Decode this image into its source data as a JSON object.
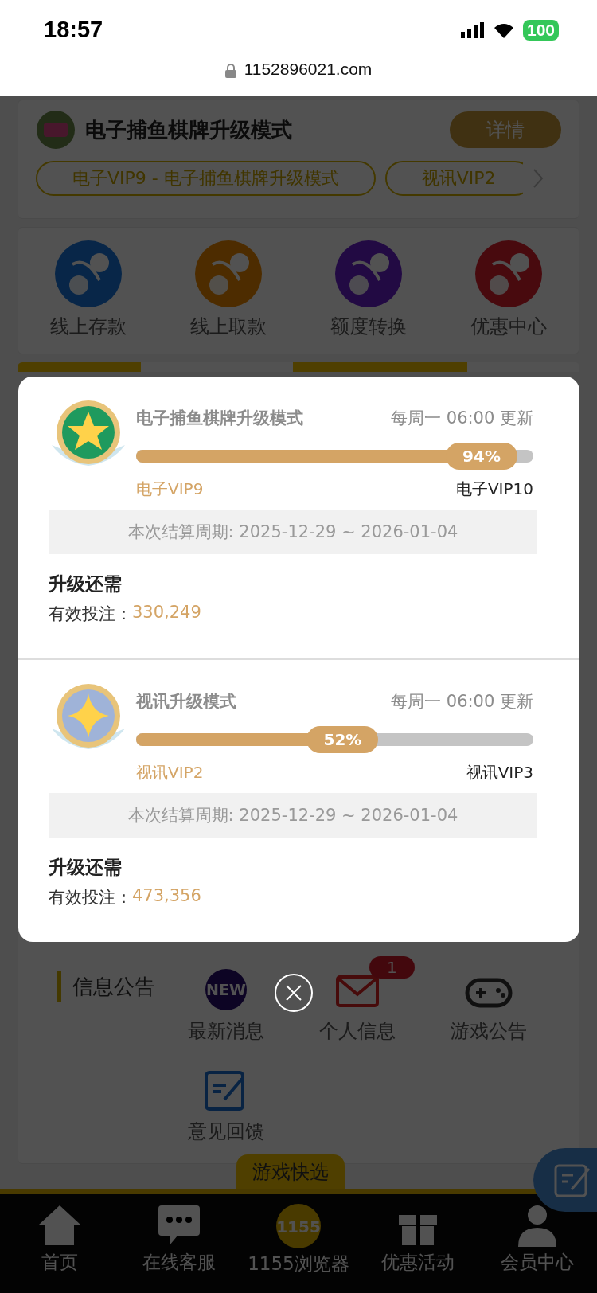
{
  "status_bar": {
    "time": "18:57",
    "battery": "100"
  },
  "browser": {
    "url": "1152896021.com"
  },
  "promo_card": {
    "title": "电子捕鱼棋牌升级模式",
    "details_button": "详情",
    "chips": [
      "电子VIP9 - 电子捕鱼棋牌升级模式",
      "视讯VIP2"
    ]
  },
  "quick_actions": [
    {
      "kind": "deposit",
      "label": "线上存款"
    },
    {
      "kind": "withdraw",
      "label": "线上取款"
    },
    {
      "kind": "transfer",
      "label": "额度转换"
    },
    {
      "kind": "promo",
      "label": "优惠中心"
    }
  ],
  "notice_section": {
    "title": "信息公告",
    "items": [
      {
        "kind": "new",
        "label": "最新消息",
        "icon_text": "NEW"
      },
      {
        "kind": "mail",
        "label": "个人信息",
        "badge": "1"
      },
      {
        "kind": "game",
        "label": "游戏公告"
      },
      {
        "kind": "feedback",
        "label": "意见回馈"
      }
    ]
  },
  "quick_pick_tab": "游戏快选",
  "bottom_nav": [
    {
      "kind": "home",
      "label": "首页"
    },
    {
      "kind": "chat",
      "label": "在线客服"
    },
    {
      "kind": "logo",
      "label": "1155浏览器",
      "logo_text": "1155"
    },
    {
      "kind": "gift",
      "label": "优惠活动"
    },
    {
      "kind": "user",
      "label": "会员中心"
    }
  ],
  "modal": {
    "tiers": [
      {
        "kind": "green",
        "title": "电子捕鱼棋牌升级模式",
        "update_note": "每周一 06:00 更新",
        "level": 0.94,
        "percent": "94%",
        "current": "电子VIP9",
        "next": "电子VIP10",
        "period": "本次结算周期: 2025-12-29 ~ 2026-01-04",
        "requirement_title": "升级还需",
        "requirement_label": "有效投注：",
        "requirement_value": "330,249"
      },
      {
        "kind": "silver",
        "title": "视讯升级模式",
        "update_note": "每周一 06:00 更新",
        "level": 0.52,
        "percent": "52%",
        "current": "视讯VIP2",
        "next": "视讯VIP3",
        "period": "本次结算周期: 2025-12-29 ~ 2026-01-04",
        "requirement_title": "升级还需",
        "requirement_label": "有效投注：",
        "requirement_value": "473,356"
      }
    ]
  }
}
